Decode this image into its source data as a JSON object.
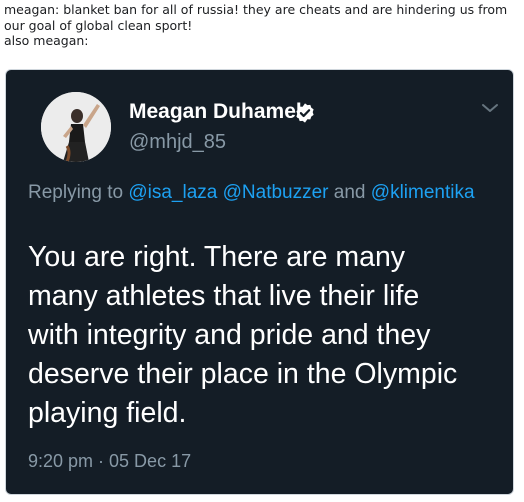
{
  "caption": {
    "lines": [
      "meagan: blanket ban for all of russia! they are cheats and are hindering us from",
      "our goal of global clean sport!",
      "also meagan:"
    ]
  },
  "tweet": {
    "display_name": "Meagan Duhamel",
    "handle": "@mhjd_85",
    "verified": true,
    "reply_prefix": "Replying to",
    "reply_mentions": [
      "@isa_laza",
      "@Natbuzzer",
      "@klimentika"
    ],
    "reply_joiner": "and",
    "text_lines": [
      "You are right. There are many",
      "many athletes that live their life",
      "with integrity and pride and they",
      "deserve their place in the Olympic",
      "playing field."
    ],
    "timestamp": "9:20 pm · 05 Dec 17"
  },
  "colors": {
    "card_background": "#141d26",
    "mention_blue": "#1da1f2",
    "muted_gray": "#8899a6",
    "text_white": "#ffffff"
  },
  "icons": {
    "verified": "verified-icon",
    "menu": "chevron-down-icon"
  }
}
